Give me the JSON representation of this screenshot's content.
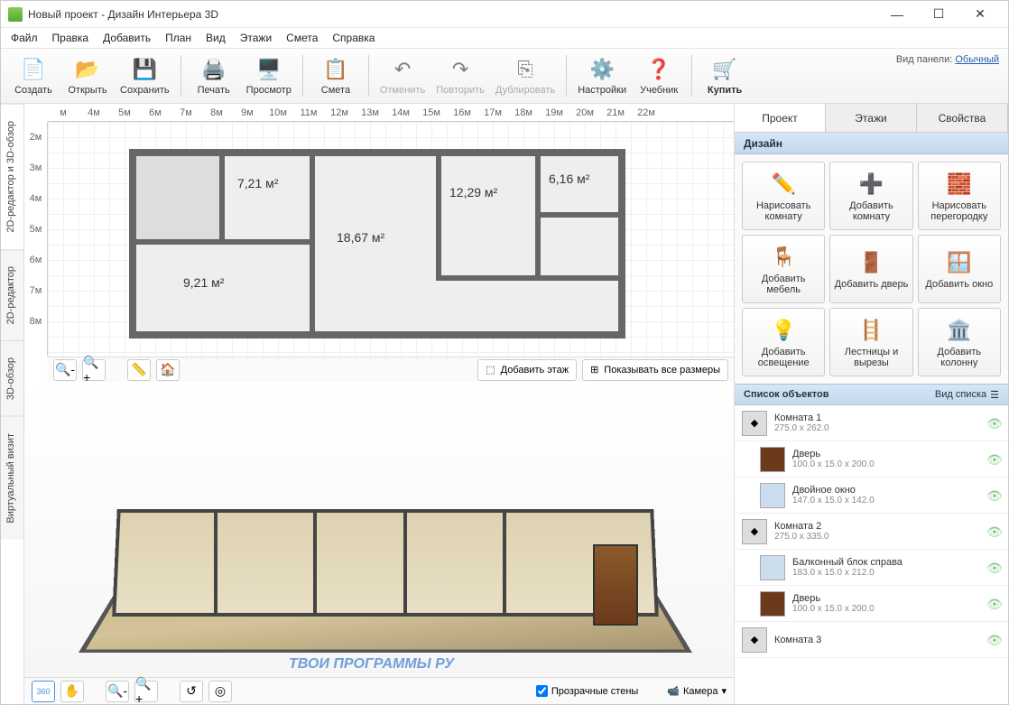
{
  "window": {
    "title": "Новый проект - Дизайн Интерьера 3D"
  },
  "menu": [
    "Файл",
    "Правка",
    "Добавить",
    "План",
    "Вид",
    "Этажи",
    "Смета",
    "Справка"
  ],
  "toolbar": {
    "create": "Создать",
    "open": "Открыть",
    "save": "Сохранить",
    "print": "Печать",
    "preview": "Просмотр",
    "estimate": "Смета",
    "undo": "Отменить",
    "redo": "Повторить",
    "duplicate": "Дублировать",
    "settings": "Настройки",
    "tutorial": "Учебник",
    "buy": "Купить",
    "panelmode_label": "Вид панели:",
    "panelmode_value": "Обычный"
  },
  "vtabs": {
    "t1": "2D-редактор и 3D-обзор",
    "t2": "2D-редактор",
    "t3": "3D-обзор",
    "t4": "Виртуальный визит"
  },
  "ruler_h": [
    "м",
    "4м",
    "5м",
    "6м",
    "7м",
    "8м",
    "9м",
    "10м",
    "11м",
    "12м",
    "13м",
    "14м",
    "15м",
    "16м",
    "17м",
    "18м",
    "19м",
    "20м",
    "21м",
    "22м"
  ],
  "ruler_v": [
    "2м",
    "3м",
    "4м",
    "5м",
    "6м",
    "7м",
    "8м"
  ],
  "rooms": {
    "r1": "7,21 м²",
    "r2": "18,67 м²",
    "r3": "12,29 м²",
    "r4": "6,16 м²",
    "r5": "9,21 м²"
  },
  "floor_btns": {
    "add_floor": "Добавить этаж",
    "show_dims": "Показывать все размеры"
  },
  "view3d": {
    "transparent_walls": "Прозрачные стены",
    "camera": "Камера"
  },
  "rtabs": {
    "project": "Проект",
    "floors": "Этажи",
    "props": "Свойства"
  },
  "design": {
    "header": "Дизайн",
    "draw_room": "Нарисовать комнату",
    "add_room": "Добавить комнату",
    "draw_partition": "Нарисовать перегородку",
    "add_furniture": "Добавить мебель",
    "add_door": "Добавить дверь",
    "add_window": "Добавить окно",
    "add_light": "Добавить освещение",
    "stairs": "Лестницы и вырезы",
    "add_column": "Добавить колонну"
  },
  "objects": {
    "header": "Список объектов",
    "viewmode": "Вид списка",
    "items": [
      {
        "name": "Комната 1",
        "dims": "275.0 x 262.0",
        "indent": false
      },
      {
        "name": "Дверь",
        "dims": "100.0 x 15.0 x 200.0",
        "indent": true
      },
      {
        "name": "Двойное окно",
        "dims": "147.0 x 15.0 x 142.0",
        "indent": true
      },
      {
        "name": "Комната 2",
        "dims": "275.0 x 335.0",
        "indent": false
      },
      {
        "name": "Балконный блок справа",
        "dims": "183.0 x 15.0 x 212.0",
        "indent": true
      },
      {
        "name": "Дверь",
        "dims": "100.0 x 15.0 x 200.0",
        "indent": true
      },
      {
        "name": "Комната 3",
        "dims": "",
        "indent": false
      }
    ]
  },
  "watermark": "ТВОИ ПРОГРАММЫ РУ"
}
